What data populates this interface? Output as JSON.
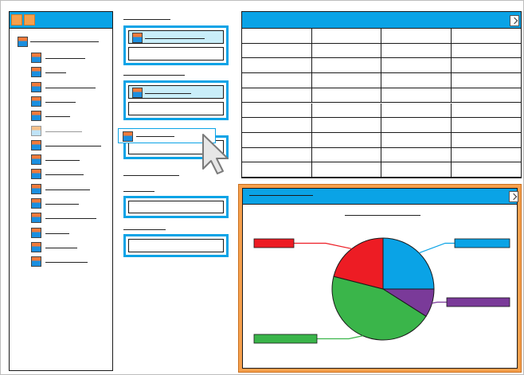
{
  "colors": {
    "panel_header": "#0aa3e6",
    "accent_orange": "#f6a04d",
    "selection_fill": "#c9eef9",
    "border": "#1a1a1a"
  },
  "tree": {
    "header_buttons": [
      "window-button-icon",
      "window-button-icon"
    ],
    "root": {
      "icon": "folder-icon"
    },
    "nodes": [
      {
        "icon": "node-icon",
        "state": "normal"
      },
      {
        "icon": "node-icon",
        "state": "normal"
      },
      {
        "icon": "node-icon",
        "state": "normal"
      },
      {
        "icon": "node-icon",
        "state": "normal"
      },
      {
        "icon": "node-icon",
        "state": "normal"
      },
      {
        "icon": "node-icon",
        "state": "dragging"
      },
      {
        "icon": "node-icon",
        "state": "normal"
      },
      {
        "icon": "node-icon",
        "state": "normal"
      },
      {
        "icon": "node-icon",
        "state": "normal"
      },
      {
        "icon": "node-icon",
        "state": "normal"
      },
      {
        "icon": "node-icon",
        "state": "normal"
      },
      {
        "icon": "node-icon",
        "state": "normal"
      },
      {
        "icon": "node-icon",
        "state": "normal"
      },
      {
        "icon": "node-icon",
        "state": "normal"
      },
      {
        "icon": "node-icon",
        "state": "normal"
      }
    ]
  },
  "table": {
    "header_icon": "export-icon",
    "columns": 4,
    "rows": 10
  },
  "chart_data": {
    "type": "pie",
    "title": "",
    "slices": [
      {
        "color": "#0aa3e6",
        "value": 25
      },
      {
        "color": "#7a3a99",
        "value": 9
      },
      {
        "color": "#3ab54a",
        "value": 45
      },
      {
        "color": "#ed1c24",
        "value": 21
      }
    ],
    "legend_placement": "callouts"
  },
  "chart_panel": {
    "header_icon": "export-icon",
    "state": "highlighted"
  },
  "cursor": {
    "icon": "mouse-pointer-icon"
  }
}
